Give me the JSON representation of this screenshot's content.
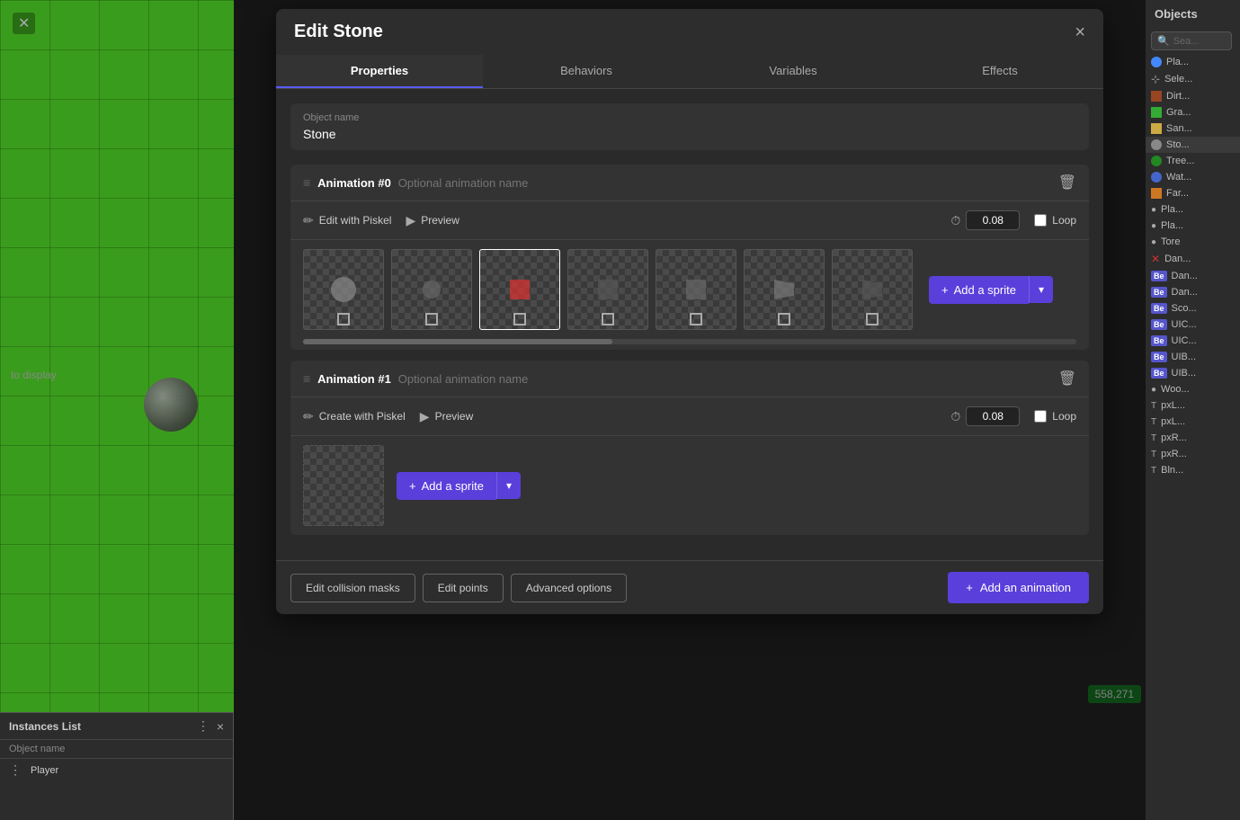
{
  "viewport": {
    "noDisplayText": "to display",
    "coords": "558,271"
  },
  "modal": {
    "title": "Edit Stone",
    "close_label": "×",
    "tabs": [
      {
        "label": "Properties",
        "active": true
      },
      {
        "label": "Behaviors",
        "active": false
      },
      {
        "label": "Variables",
        "active": false
      },
      {
        "label": "Effects",
        "active": false
      }
    ],
    "objectName": {
      "label": "Object name",
      "value": "Stone"
    },
    "animations": [
      {
        "id": "anim0",
        "label": "Animation #0",
        "namePlaceholder": "Optional animation name",
        "editBtnLabel": "Edit with Piskel",
        "previewBtnLabel": "Preview",
        "speed": "0.08",
        "loop": false,
        "loopLabel": "Loop",
        "addSpriteLabel": "Add a sprite",
        "frames": 7
      },
      {
        "id": "anim1",
        "label": "Animation #1",
        "namePlaceholder": "Optional animation name",
        "createBtnLabel": "Create with Piskel",
        "previewBtnLabel": "Preview",
        "speed": "0.08",
        "loop": false,
        "loopLabel": "Loop",
        "addSpriteLabel": "Add a sprite",
        "frames": 1
      }
    ],
    "footer": {
      "editCollisionMasks": "Edit collision masks",
      "editPoints": "Edit points",
      "advancedOptions": "Advanced options",
      "addAnimation": "Add an animation"
    }
  },
  "instancesList": {
    "title": "Instances List",
    "closeLabel": "×",
    "cols": [
      "Object name",
      ""
    ],
    "rows": [
      {
        "name": "Player",
        "dots": "⋮"
      }
    ]
  },
  "objectsPanel": {
    "header": "Objects",
    "searchPlaceholder": "Sea...",
    "items": [
      {
        "label": "Pla...",
        "color": "#4488ff",
        "type": "circle"
      },
      {
        "label": "Sele...",
        "color": "#aaa",
        "type": "select"
      },
      {
        "label": "Dirt...",
        "color": "#994422",
        "type": "square"
      },
      {
        "label": "Gra...",
        "color": "#33aa33",
        "type": "square"
      },
      {
        "label": "San...",
        "color": "#ccaa44",
        "type": "square"
      },
      {
        "label": "Sto...",
        "color": "#888888",
        "type": "circle"
      },
      {
        "label": "Tree...",
        "color": "#228822",
        "type": "circle"
      },
      {
        "label": "Wat...",
        "color": "#4466cc",
        "type": "circle"
      },
      {
        "label": "Far...",
        "color": "#cc7722",
        "type": "square"
      },
      {
        "label": "Pla...",
        "color": "#aaa",
        "type": "dot"
      },
      {
        "label": "Pla...",
        "color": "#aaa",
        "type": "dot"
      },
      {
        "label": "Tore",
        "color": "#aaa",
        "type": "dot"
      },
      {
        "label": "Dan...",
        "color": "#cc3333",
        "type": "x"
      },
      {
        "label": "Dan...",
        "color": "#5555cc",
        "type": "be"
      },
      {
        "label": "Dan...",
        "color": "#5555cc",
        "type": "be"
      },
      {
        "label": "Sco...",
        "color": "#5555cc",
        "type": "be"
      },
      {
        "label": "UIC...",
        "color": "#5555cc",
        "type": "be"
      },
      {
        "label": "UIC...",
        "color": "#5555cc",
        "type": "be"
      },
      {
        "label": "UIB...",
        "color": "#5555cc",
        "type": "be"
      },
      {
        "label": "UIB...",
        "color": "#5555cc",
        "type": "be"
      },
      {
        "label": "Woo...",
        "color": "#aaa",
        "type": "dot"
      },
      {
        "label": "pxL...",
        "color": "#aaa",
        "type": "text"
      },
      {
        "label": "pxL...",
        "color": "#aaa",
        "type": "text"
      },
      {
        "label": "pxR...",
        "color": "#aaa",
        "type": "text"
      },
      {
        "label": "pxR...",
        "color": "#aaa",
        "type": "text"
      },
      {
        "label": "Bln...",
        "color": "#aaa",
        "type": "text"
      }
    ]
  }
}
